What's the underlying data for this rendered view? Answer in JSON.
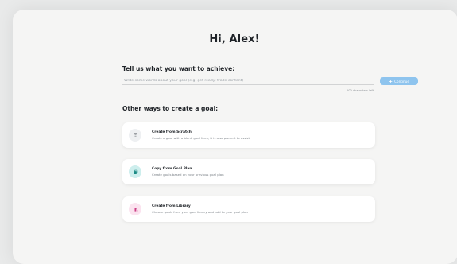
{
  "header": {
    "greeting": "Hi, Alex!"
  },
  "goal_prompt": {
    "label": "Tell us what you want to achieve:",
    "input_value": "",
    "placeholder": "Write some words about your goal (e.g. get ready: trade content)",
    "continue_label": "Continue",
    "char_count": "200 characters left"
  },
  "other_ways": {
    "label": "Other ways to create a goal:",
    "cards": [
      {
        "title": "Create from Scratch",
        "description": "Create a goal with a blank goal form, it is also present to assist",
        "icon": "document-icon",
        "icon_bg": "#eef0f2",
        "icon_color": "#6b7177"
      },
      {
        "title": "Copy from Goal Plan",
        "description": "Create goals based on your previous goal plan",
        "icon": "copy-icon",
        "icon_bg": "#cdeeed",
        "icon_color": "#1b8a84"
      },
      {
        "title": "Create from Library",
        "description": "Choose goals from your goal library and add to your goal plan",
        "icon": "library-icon",
        "icon_bg": "#fbe3ef",
        "icon_color": "#cc3f86"
      }
    ]
  },
  "colors": {
    "accent": "#8ec4ee",
    "panel": "#f5f5f4",
    "background": "#e9eaea"
  }
}
